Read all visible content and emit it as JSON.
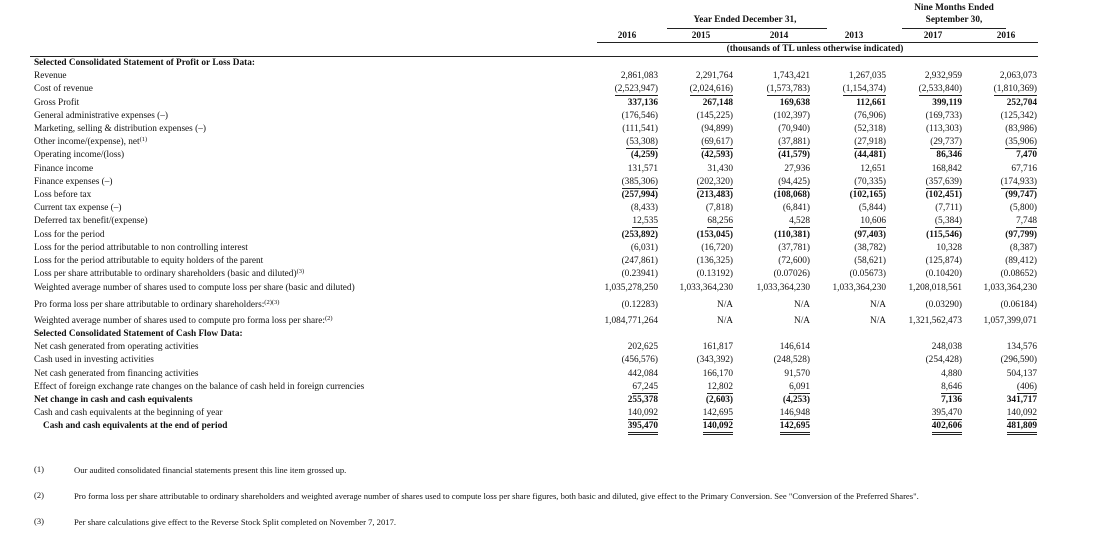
{
  "header": {
    "nine_months_line1": "Nine Months Ended",
    "nine_months_line2": "September 30,",
    "year_ended": "Year Ended December 31,",
    "units": "(thousands of TL unless otherwise indicated)",
    "columns": [
      "2016",
      "2015",
      "2014",
      "2013",
      "2017",
      "2016"
    ]
  },
  "rows": [
    {
      "label": "Selected Consolidated Statement of Profit or Loss Data:",
      "section": true,
      "values": []
    },
    {
      "label": "Revenue",
      "values": [
        "2,861,083",
        "2,291,764",
        "1,743,421",
        "1,267,035",
        "2,932,959",
        "2,063,073"
      ]
    },
    {
      "label": "Cost of revenue",
      "values": [
        "(2,523,947)",
        "(2,024,616)",
        "(1,573,783)",
        "(1,154,374)",
        "(2,533,840)",
        "(1,810,369)"
      ],
      "underline": true
    },
    {
      "label": "Gross Profit",
      "bold_values": true,
      "values": [
        "337,136",
        "267,148",
        "169,638",
        "112,661",
        "399,119",
        "252,704"
      ]
    },
    {
      "label": "General administrative expenses (–)",
      "values": [
        "(176,546)",
        "(145,225)",
        "(102,397)",
        "(76,906)",
        "(169,733)",
        "(125,342)"
      ]
    },
    {
      "label": "Marketing, selling & distribution expenses (–)",
      "values": [
        "(111,541)",
        "(94,899)",
        "(70,940)",
        "(52,318)",
        "(113,303)",
        "(83,986)"
      ]
    },
    {
      "label": "Other income/(expense), net",
      "sup": "(1)",
      "values": [
        "(53,308)",
        "(69,617)",
        "(37,881)",
        "(27,918)",
        "(29,737)",
        "(35,906)"
      ],
      "underline": true
    },
    {
      "label": "Operating income/(loss)",
      "bold_values": true,
      "values": [
        "(4,259)",
        "(42,593)",
        "(41,579)",
        "(44,481)",
        "86,346",
        "7,470"
      ]
    },
    {
      "label": "Finance income",
      "values": [
        "131,571",
        "31,430",
        "27,936",
        "12,651",
        "168,842",
        "67,716"
      ]
    },
    {
      "label": "Finance expenses (–)",
      "values": [
        "(385,306)",
        "(202,320)",
        "(94,425)",
        "(70,335)",
        "(357,639)",
        "(174,933)"
      ],
      "underline": true
    },
    {
      "label": "Loss before tax",
      "bold_values": true,
      "values": [
        "(257,994)",
        "(213,483)",
        "(108,068)",
        "(102,165)",
        "(102,451)",
        "(99,747)"
      ]
    },
    {
      "label": "Current tax expense (–)",
      "values": [
        "(8,433)",
        "(7,818)",
        "(6,841)",
        "(5,844)",
        "(7,711)",
        "(5,800)"
      ]
    },
    {
      "label": "Deferred tax benefit/(expense)",
      "values": [
        "12,535",
        "68,256",
        "4,528",
        "10,606",
        "(5,384)",
        "7,748"
      ],
      "underline": true
    },
    {
      "label": "Loss for the period",
      "bold_values": true,
      "values": [
        "(253,892)",
        "(153,045)",
        "(110,381)",
        "(97,403)",
        "(115,546)",
        "(97,799)"
      ]
    },
    {
      "label": "Loss for the period attributable to non controlling interest",
      "values": [
        "(6,031)",
        "(16,720)",
        "(37,781)",
        "(38,782)",
        "10,328",
        "(8,387)"
      ]
    },
    {
      "label": "Loss for the period attributable to equity holders of the parent",
      "values": [
        "(247,861)",
        "(136,325)",
        "(72,600)",
        "(58,621)",
        "(125,874)",
        "(89,412)"
      ]
    },
    {
      "label": "Loss per share attributable to ordinary shareholders (basic and diluted)",
      "sup": "(3)",
      "values": [
        "(0.23941)",
        "(0.13192)",
        "(0.07026)",
        "(0.05673)",
        "(0.10420)",
        "(0.08652)"
      ]
    },
    {
      "label": "Weighted average number of shares used to compute loss per share (basic and diluted)",
      "values": [
        "1,035,278,250",
        "1,033,364,230",
        "1,033,364,230",
        "1,033,364,230",
        "1,208,018,561",
        "1,033,364,230"
      ]
    },
    {
      "label": "Pro forma loss per share attributable to ordinary shareholders:",
      "sup": "(2)(3)",
      "values": [
        "(0.12283)",
        "N/A",
        "N/A",
        "N/A",
        "(0.03290)",
        "(0.06184)"
      ]
    },
    {
      "label": "Weighted average number of shares used to compute pro forma loss per share:",
      "sup": "(2)",
      "values": [
        "1,084,771,264",
        "N/A",
        "N/A",
        "N/A",
        "1,321,562,473",
        "1,057,399,071"
      ]
    },
    {
      "label": "Selected Consolidated Statement of Cash Flow Data:",
      "section": true,
      "values": []
    },
    {
      "label": "Net cash generated from operating activities",
      "values": [
        "202,625",
        "161,817",
        "146,614",
        "",
        "248,038",
        "134,576"
      ]
    },
    {
      "label": "Cash used in investing activities",
      "values": [
        "(456,576)",
        "(343,392)",
        "(248,528)",
        "",
        "(254,428)",
        "(296,590)"
      ]
    },
    {
      "label": "Net cash generated from financing activities",
      "values": [
        "442,084",
        "166,170",
        "91,570",
        "",
        "4,880",
        "504,137"
      ]
    },
    {
      "label": "Effect of foreign exchange rate changes on the balance of cash held in foreign currencies",
      "values": [
        "67,245",
        "12,802",
        "6,091",
        "",
        "8,646",
        "(406)"
      ],
      "underline": true
    },
    {
      "label": "Net change in cash and cash equivalents",
      "bold": true,
      "bold_values": true,
      "values": [
        "255,378",
        "(2,603)",
        "(4,253)",
        "",
        "7,136",
        "341,717"
      ]
    },
    {
      "label": "Cash and cash equivalents at the beginning of year",
      "values": [
        "140,092",
        "142,695",
        "146,948",
        "",
        "395,470",
        "140,092"
      ],
      "underline": true
    },
    {
      "label": "Cash and cash equivalents at the end of period",
      "bold": true,
      "bold_values": true,
      "indent": true,
      "values": [
        "395,470",
        "140,092",
        "142,695",
        "",
        "402,606",
        "481,809"
      ],
      "double": true
    }
  ],
  "footnotes": [
    {
      "mark": "(1)",
      "text": "Our audited consolidated financial statements present this line item grossed up."
    },
    {
      "mark": "(2)",
      "text": "Pro forma loss per share attributable to ordinary shareholders and weighted average number of shares used to compute loss per share figures, both basic and diluted, give effect to the Primary Conversion. See \"Conversion of the Preferred Shares\"."
    },
    {
      "mark": "(3)",
      "text": "Per share calculations give effect to the Reverse Stock Split completed on November 7, 2017."
    }
  ]
}
